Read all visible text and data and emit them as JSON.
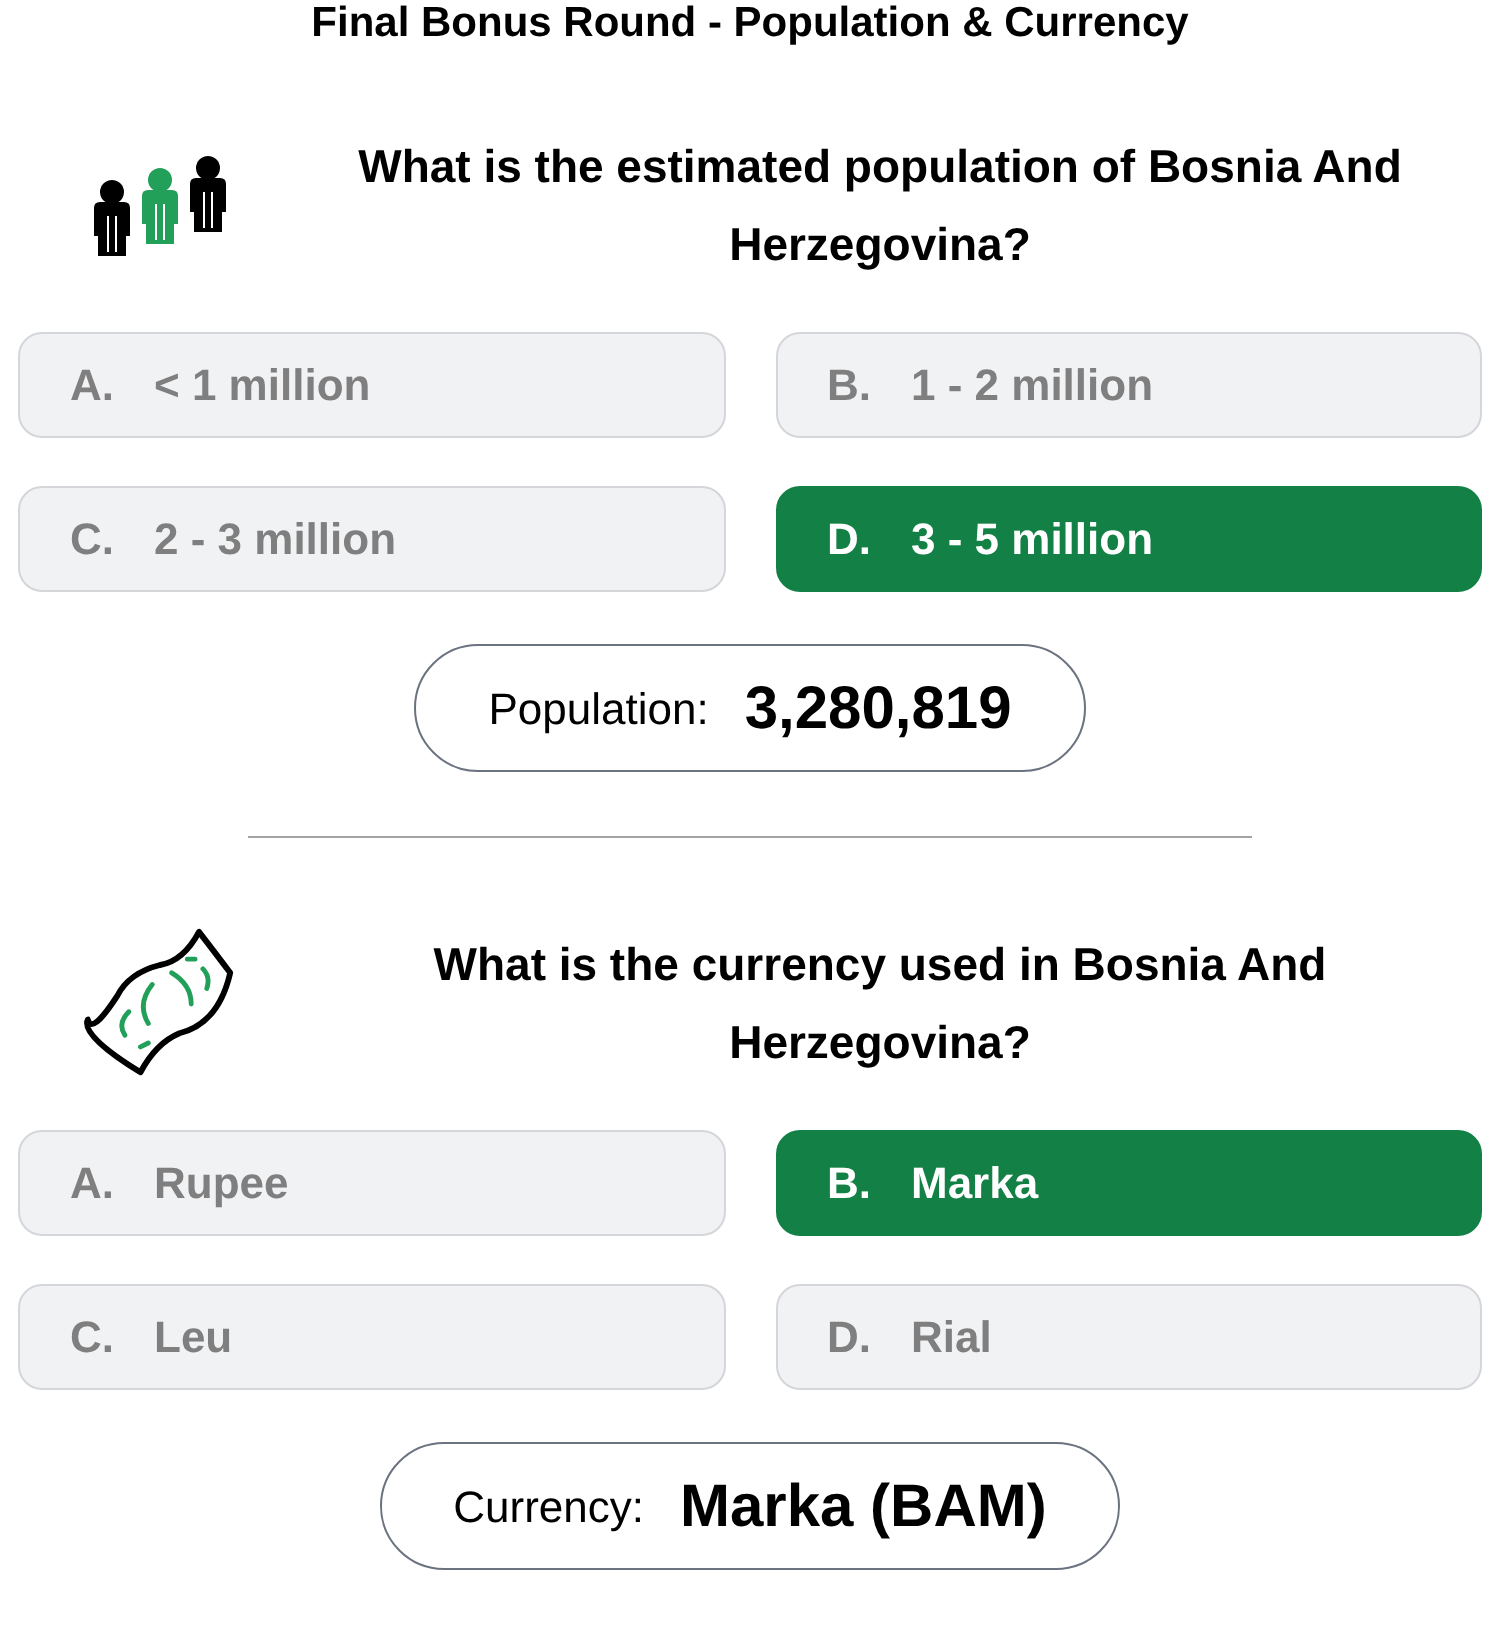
{
  "title": "Final Bonus Round - Population & Currency",
  "questions": [
    {
      "kind": "population",
      "question": "What is the estimated population of Bosnia And Herzegovina?",
      "options": [
        {
          "letter": "A.",
          "text": "< 1 million",
          "selected": false
        },
        {
          "letter": "B.",
          "text": "1 - 2 million",
          "selected": false
        },
        {
          "letter": "C.",
          "text": "2 - 3 million",
          "selected": false
        },
        {
          "letter": "D.",
          "text": "3 - 5 million",
          "selected": true
        }
      ],
      "answer": {
        "label": "Population:",
        "value": "3,280,819"
      }
    },
    {
      "kind": "currency",
      "question": "What is the currency used in Bosnia And Herzegovina?",
      "options": [
        {
          "letter": "A.",
          "text": "Rupee",
          "selected": false
        },
        {
          "letter": "B.",
          "text": "Marka",
          "selected": true
        },
        {
          "letter": "C.",
          "text": "Leu",
          "selected": false
        },
        {
          "letter": "D.",
          "text": "Rial",
          "selected": false
        }
      ],
      "answer": {
        "label": "Currency:",
        "value": "Marka (BAM)"
      }
    }
  ]
}
